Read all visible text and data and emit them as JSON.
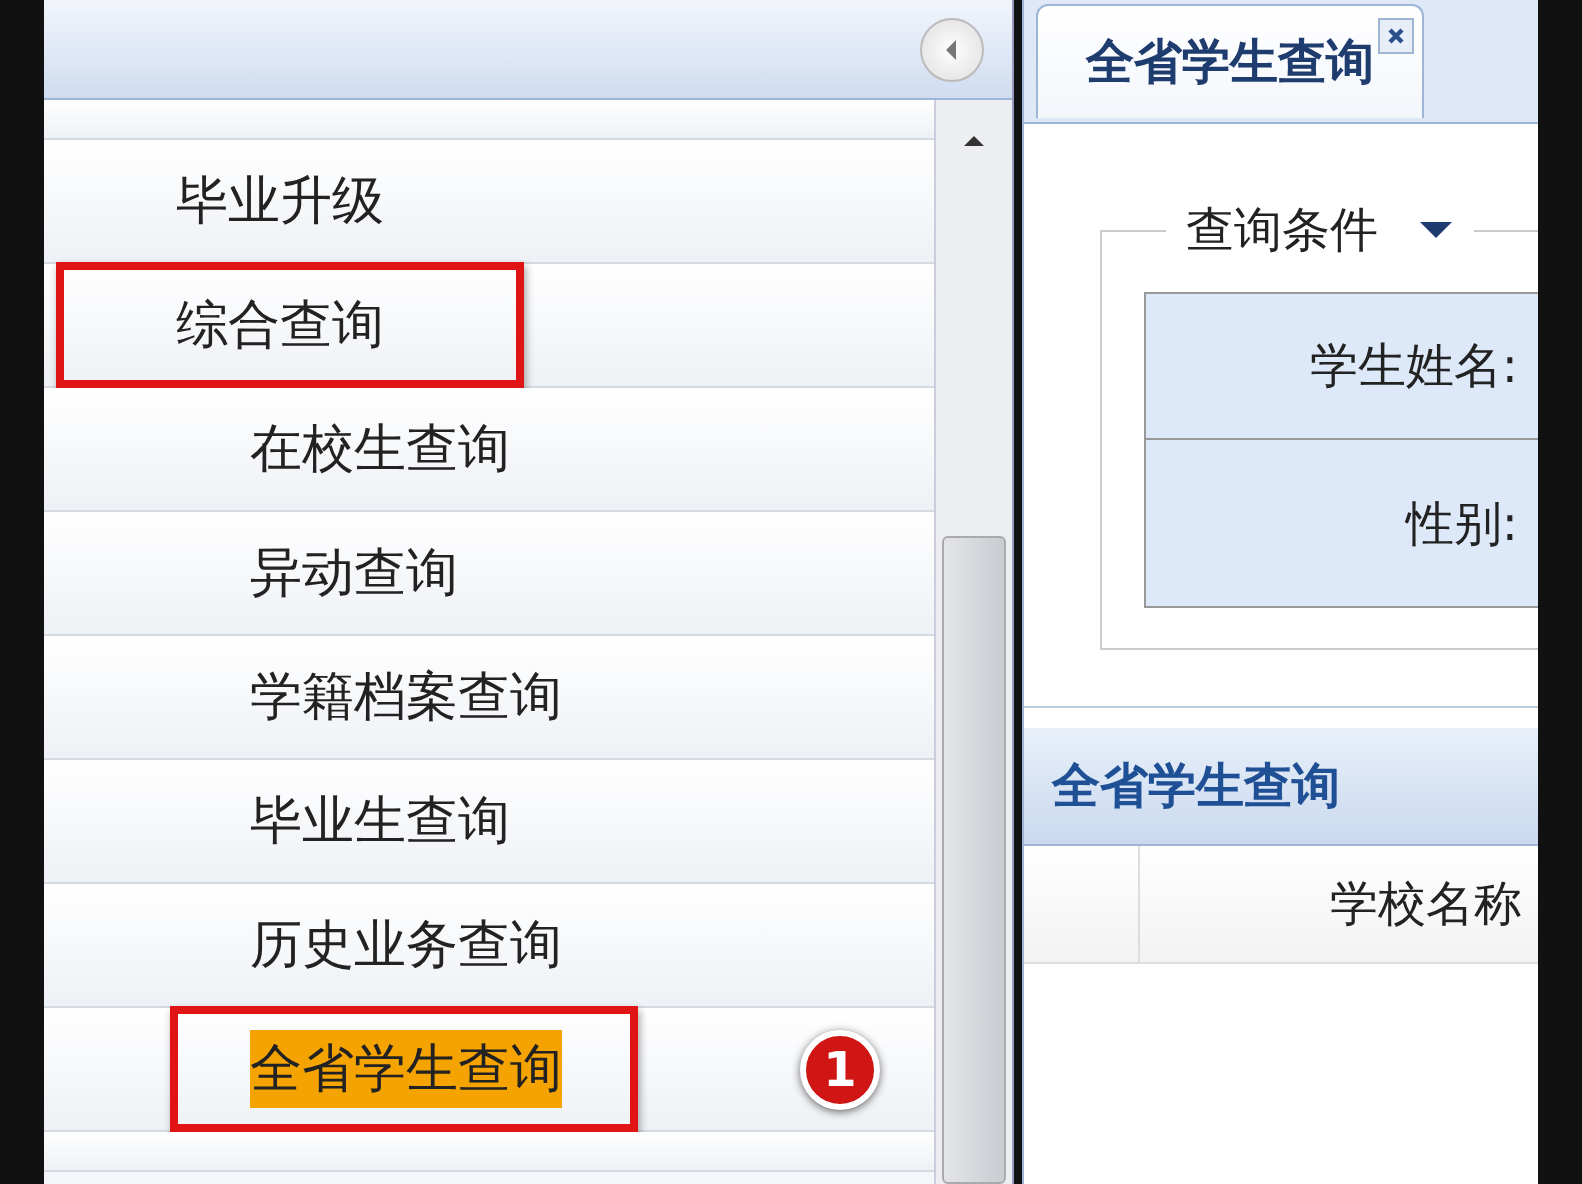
{
  "sidebar": {
    "items": [
      {
        "label": "毕业升级",
        "selected": false,
        "annotated": false
      },
      {
        "label": "综合查询",
        "selected": false,
        "annotated": true,
        "children": [
          {
            "label": "在校生查询",
            "selected": false,
            "annotated": false
          },
          {
            "label": "异动查询",
            "selected": false,
            "annotated": false
          },
          {
            "label": "学籍档案查询",
            "selected": false,
            "annotated": false
          },
          {
            "label": "毕业生查询",
            "selected": false,
            "annotated": false
          },
          {
            "label": "历史业务查询",
            "selected": false,
            "annotated": false
          },
          {
            "label": "全省学生查询",
            "selected": true,
            "annotated": true,
            "badge": "1"
          }
        ]
      }
    ]
  },
  "tab": {
    "title": "全省学生查询"
  },
  "query_panel": {
    "legend": "查询条件",
    "fields": [
      {
        "label": "学生姓名:"
      },
      {
        "label": "性别:"
      }
    ]
  },
  "grid": {
    "title": "全省学生查询",
    "columns": [
      "学校名称"
    ]
  }
}
